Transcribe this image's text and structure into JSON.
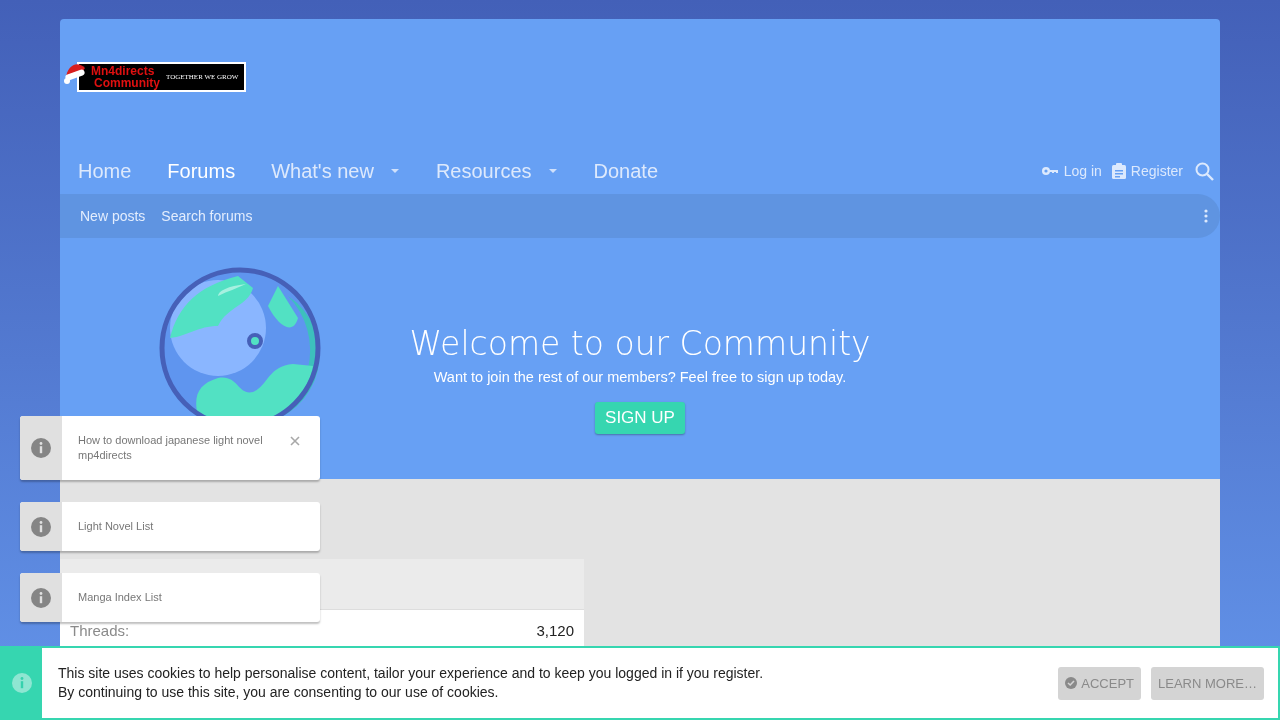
{
  "logo": {
    "title_line_1": "Mn4directs",
    "title_line_2": "Community",
    "tagline": "TOGETHER WE GROW"
  },
  "nav": [
    {
      "label": "Home",
      "selected": false,
      "has_menu": false
    },
    {
      "label": "Forums",
      "selected": true,
      "has_menu": false
    },
    {
      "label": "What's new",
      "selected": false,
      "has_menu": true
    },
    {
      "label": "Resources",
      "selected": false,
      "has_menu": true
    },
    {
      "label": "Donate",
      "selected": false,
      "has_menu": false
    }
  ],
  "account_links": [
    {
      "kind": "key",
      "label": "Log in"
    },
    {
      "kind": "clipboard",
      "label": "Register"
    }
  ],
  "sub_nav": [
    "New posts",
    "Search forums"
  ],
  "banner": {
    "title": "Welcome to our Community",
    "subtitle": "Want to join the rest of our members? Feel free to sign up today.",
    "button": "SIGN UP"
  },
  "stats": [
    {
      "label": "Threads:",
      "value": "3,120"
    }
  ],
  "notices": [
    {
      "text": "How to download japanese light novel mp4directs",
      "closable": true
    },
    {
      "text": "Light Novel List",
      "closable": false
    },
    {
      "text": "Manga Index List",
      "closable": false
    }
  ],
  "cookie_notice": {
    "lines": [
      "This site uses cookies to help personalise content, tailor your experience and to keep you logged in if you register.",
      "By continuing to use this site, you are consenting to our use of cookies."
    ],
    "accept": "ACCEPT",
    "learn_more": "LEARN MORE…"
  }
}
